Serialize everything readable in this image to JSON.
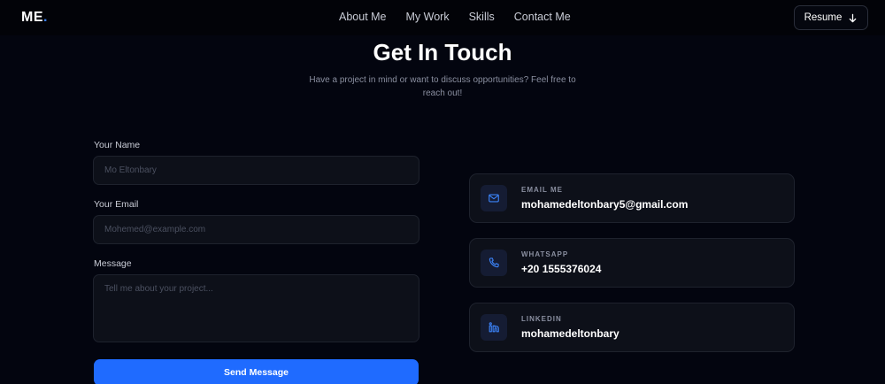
{
  "nav": {
    "logo_text": "ME",
    "logo_dot": ".",
    "links": [
      "About Me",
      "My Work",
      "Skills",
      "Contact Me"
    ],
    "resume_label": "Resume"
  },
  "header": {
    "title": "Get In Touch",
    "subtitle": "Have a project in mind or want to discuss opportunities? Feel free to reach out!"
  },
  "form": {
    "name_label": "Your Name",
    "name_placeholder": "Mo Eltonbary",
    "email_label": "Your Email",
    "email_placeholder": "Mohemed@example.com",
    "message_label": "Message",
    "message_placeholder": "Tell me about your project...",
    "submit_label": "Send Message"
  },
  "contacts": [
    {
      "label": "EMAIL ME",
      "value": "mohamedeltonbary5@gmail.com",
      "icon": "mail-icon"
    },
    {
      "label": "WHATSAPP",
      "value": "+20 1555376024",
      "icon": "phone-icon"
    },
    {
      "label": "LINKEDIN",
      "value": "mohamedeltonbary",
      "icon": "linkedin-icon"
    }
  ],
  "colors": {
    "background": "#03050f",
    "accent": "#1f6bff",
    "card": "#0d1019"
  }
}
